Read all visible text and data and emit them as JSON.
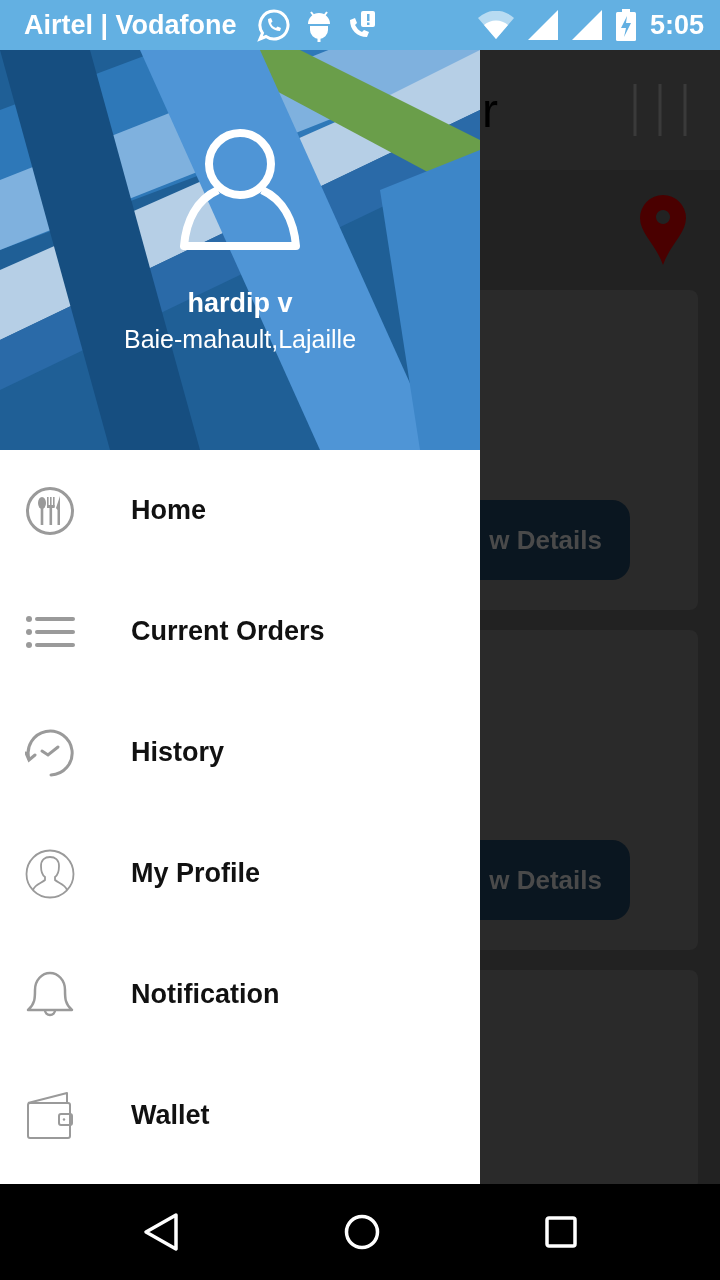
{
  "status_bar": {
    "carrier": "Airtel | Vodafone",
    "time": "5:05"
  },
  "background_screen": {
    "title": "r",
    "cards": [
      {
        "button": "w Details"
      },
      {
        "button": "w Details"
      }
    ]
  },
  "drawer": {
    "user_name": "hardip v",
    "location": "Baie-mahault,Lajaille",
    "items": [
      {
        "label": "Home"
      },
      {
        "label": "Current Orders"
      },
      {
        "label": "History"
      },
      {
        "label": "My Profile"
      },
      {
        "label": "Notification"
      },
      {
        "label": "Wallet"
      }
    ]
  }
}
